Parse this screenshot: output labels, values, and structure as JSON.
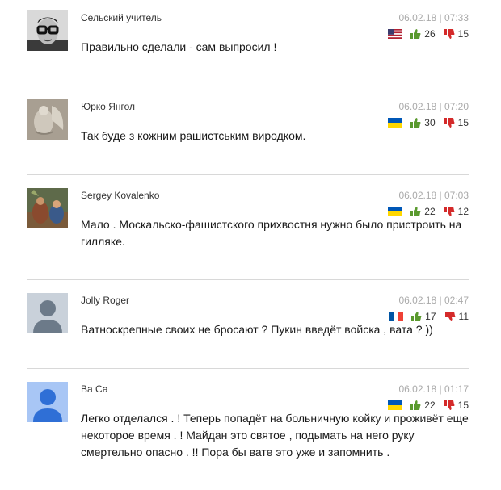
{
  "comments": [
    {
      "author": "Сельский учитель",
      "date": "06.02.18 | 07:33",
      "flag": "usa-flag-icon",
      "likes": "26",
      "dislikes": "15",
      "text": "Правильно сделали - сам выпросил !",
      "avatar": "buddy-holly-photo"
    },
    {
      "author": "Юрко Янгол",
      "date": "06.02.18 | 07:20",
      "flag": "ukraine-flag-icon",
      "likes": "30",
      "dislikes": "15",
      "text": "Так буде з кожним рашистським виродком.",
      "avatar": "angel-statue-photo"
    },
    {
      "author": "Sergey Kovalenko",
      "date": "06.02.18 | 07:03",
      "flag": "ukraine-flag-icon",
      "likes": "22",
      "dislikes": "12",
      "text": "Мало . Москальско-фашистского прихвостня нужно было пристроить на гилляке.",
      "avatar": "painting-photo"
    },
    {
      "author": "Jolly Roger",
      "date": "06.02.18 | 02:47",
      "flag": "france-flag-icon",
      "likes": "17",
      "dislikes": "11",
      "text": "Ватноскрепные своих не бросают ? Пукин введёт войска , вата ? ))",
      "avatar": "default-gray-avatar"
    },
    {
      "author": "Ва Са",
      "date": "06.02.18 | 01:17",
      "flag": "ukraine-flag-icon",
      "likes": "22",
      "dislikes": "15",
      "text": "Легко отделался . ! Теперь попадёт на больничную койку и проживёт еще некоторое время . ! Майдан это святое , подымать на него руку смертельно опасно . !! Пора бы вате это уже и запомнить .",
      "avatar": "default-blue-avatar"
    }
  ],
  "colors": {
    "like": "#5a9a2e",
    "dislike": "#d42a2a",
    "meta": "#aaaaaa",
    "divider": "#d8d8d8"
  }
}
